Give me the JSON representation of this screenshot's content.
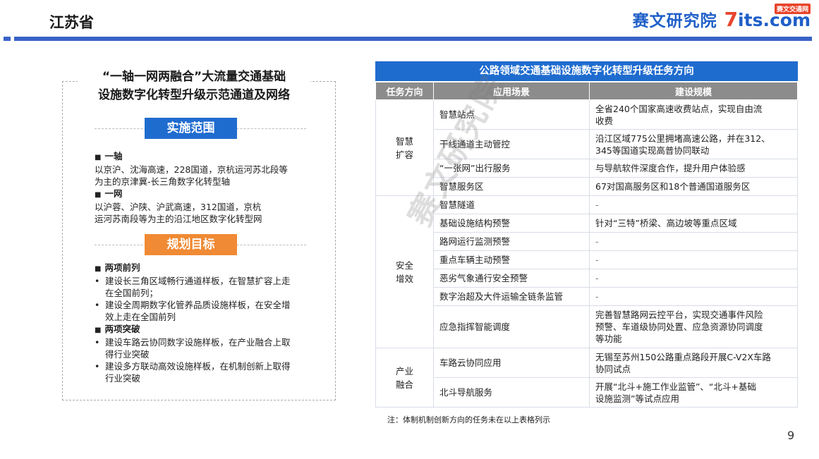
{
  "header": {
    "title": "江苏省",
    "brand_cn": "赛文研究院",
    "brand_logo_seven": "7",
    "brand_logo_rest": "its.com",
    "brand_badge": "赛文交通网"
  },
  "left": {
    "title_line1": "“一轴一网两融合”大流量交通基础",
    "title_line2": "设施数字化转型升级示范通道及网络",
    "scope_pill": "实施范围",
    "scope": [
      {
        "heading": "一轴",
        "text_lines": [
          "以京沪、沈海高速，228国道，京杭运河苏北段等",
          "为主的京津冀-长三角数字化转型轴"
        ]
      },
      {
        "heading": "一网",
        "text_lines": [
          "以沪蓉、沪陕、沪武高速，312国道，京杭",
          "运河苏南段等为主的沿江地区数字化转型网"
        ]
      }
    ],
    "goal_pill": "规划目标",
    "goals": [
      {
        "heading": "两项前列",
        "items": [
          [
            "建设长三角区域畅行通道样板，在智慧扩容上走",
            "在全国前列；"
          ],
          [
            "建设全周期数字化管养品质设施样板，在安全增",
            "效上走在全国前列"
          ]
        ]
      },
      {
        "heading": "两项突破",
        "items": [
          [
            "建设车路云协同数字设施样板，在产业融合上取",
            "得行业突破"
          ],
          [
            "建设多方联动高效设施样板，在机制创新上取得",
            "行业突破"
          ]
        ]
      }
    ]
  },
  "table": {
    "title": "公路领域交通基础设施数字化转型升级任务方向",
    "headers": [
      "任务方向",
      "应用场景",
      "建设规模"
    ],
    "groups": [
      {
        "category_lines": [
          "智慧",
          "扩容"
        ],
        "rows": [
          {
            "scene": "智慧站点",
            "scale_lines": [
              "全省240个国家高速收费站点，实现自由流",
              "收费"
            ]
          },
          {
            "scene": "干线通道主动管控",
            "scale_lines": [
              "沿江区域775公里拥堵高速公路，并在312、",
              "345等国道实现高普协同联动"
            ]
          },
          {
            "scene": "“一张网”出行服务",
            "scale_lines": [
              "与导航软件深度合作，提升用户体验感"
            ]
          },
          {
            "scene": "智慧服务区",
            "scale_lines": [
              "67对国高服务区和18个普通国道服务区"
            ]
          }
        ]
      },
      {
        "category_lines": [
          "安全",
          "增效"
        ],
        "rows": [
          {
            "scene": "智慧隧道",
            "scale_lines": [
              "-"
            ]
          },
          {
            "scene": "基础设施结构预警",
            "scale_lines": [
              "针对“三特”桥梁、高边坡等重点区域"
            ]
          },
          {
            "scene": "路网运行监测预警",
            "scale_lines": [
              "-"
            ]
          },
          {
            "scene": "重点车辆主动预警",
            "scale_lines": [
              "-"
            ]
          },
          {
            "scene": "恶劣气象通行安全预警",
            "scale_lines": [
              "-"
            ]
          },
          {
            "scene": "数字治超及大件运输全链条监管",
            "scale_lines": [
              "-"
            ]
          },
          {
            "scene": "应急指挥智能调度",
            "scale_lines": [
              "完善智慧路网云控平台，实现交通事件风险",
              "预警、车道级协同处置、应急资源协同调度",
              "等功能"
            ]
          }
        ]
      },
      {
        "category_lines": [
          "产业",
          "融合"
        ],
        "rows": [
          {
            "scene": "车路云协同应用",
            "scale_lines": [
              "无锡至苏州150公路重点路段开展C-V2X车路",
              "协同试点"
            ]
          },
          {
            "scene": "北斗导航服务",
            "scale_lines": [
              "开展“北斗+施工作业监管”、“北斗+基础",
              "设施监测”等试点应用"
            ]
          }
        ]
      }
    ],
    "note": "注：体制机制创新方向的任务未在以上表格列示"
  },
  "watermark": "赛文研究院",
  "page_number": "9"
}
